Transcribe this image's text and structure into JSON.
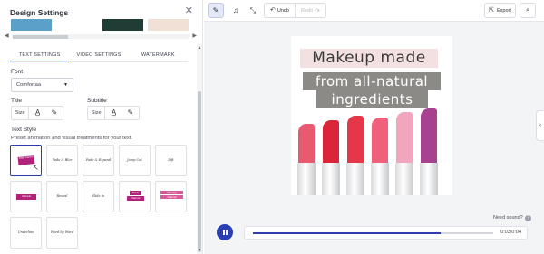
{
  "panel": {
    "title": "Design Settings",
    "close_icon": "close-icon",
    "colors": [
      "#5ba0c8",
      "#ffffff",
      "#1f3d35",
      "#f1e0d6"
    ],
    "tabs": [
      {
        "label": "TEXT SETTINGS",
        "active": true
      },
      {
        "label": "VIDEO SETTINGS",
        "active": false
      },
      {
        "label": "WATERMARK",
        "active": false
      }
    ],
    "font_label": "Font",
    "font_value": "Comfortaa",
    "title_label": "Title",
    "subtitle_label": "Subtitle",
    "size_label": "Size",
    "text_style_label": "Text Style",
    "text_style_desc": "Preset animation and visual treatments for your text.",
    "styles": [
      {
        "name": "style-1",
        "caption": "",
        "selected": true
      },
      {
        "name": "style-fade-blur",
        "caption": "Fade & Blur"
      },
      {
        "name": "style-fade-expand",
        "caption": "Fade & Expand"
      },
      {
        "name": "style-jump-cut",
        "caption": "Jump Cut"
      },
      {
        "name": "style-lift",
        "caption": "Lift"
      },
      {
        "name": "style-pink-block",
        "caption": ""
      },
      {
        "name": "style-reveal",
        "caption": "Reveal"
      },
      {
        "name": "style-slide-in",
        "caption": "Slide In"
      },
      {
        "name": "style-pink-stack",
        "caption": ""
      },
      {
        "name": "style-pink-line",
        "caption": ""
      },
      {
        "name": "style-underline",
        "caption": "Underline"
      },
      {
        "name": "style-word-by-word",
        "caption": "Word by Word"
      }
    ]
  },
  "toolbar": {
    "undo_label": "Undo",
    "redo_label": "Redo",
    "export_label": "Export"
  },
  "preview": {
    "line1": "Makeup made",
    "line2": "from all-natural",
    "line3": "ingredients",
    "lipstick_colors": [
      "#e85a70",
      "#d92638",
      "#e6364a",
      "#f0607a",
      "#f2a6bd",
      "#a6428f"
    ]
  },
  "player": {
    "need_sound": "Need sound?",
    "time": "0:03/0:04",
    "progress": 0.78
  },
  "accent": "#2a3fb4"
}
